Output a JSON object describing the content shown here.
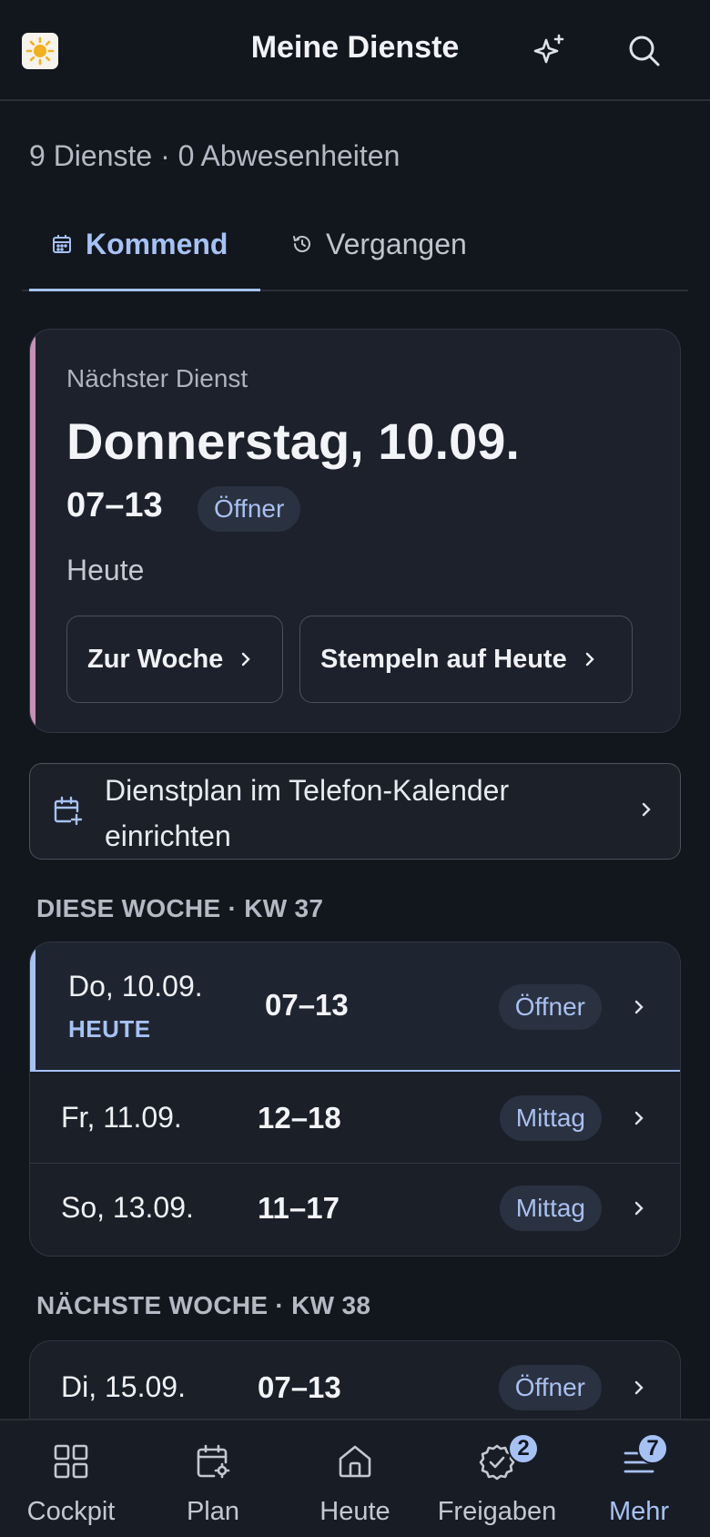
{
  "header": {
    "title": "Meine Dienste",
    "logo_icon": "sun-icon",
    "actions": [
      "sparkles-icon",
      "search-icon"
    ]
  },
  "summary": "9 Dienste · 0 Abwesenheiten",
  "tabs": [
    {
      "label": "Kommend",
      "icon": "calendar-icon",
      "active": true
    },
    {
      "label": "Vergangen",
      "icon": "history-icon",
      "active": false
    }
  ],
  "next_shift": {
    "label": "Nächster Dienst",
    "date": "Donnerstag, 10.09.",
    "time": "07–13",
    "role": "Öffner",
    "relative": "Heute",
    "btn_week": "Zur Woche",
    "btn_clock": "Stempeln auf Heute"
  },
  "calendar_banner": {
    "text": "Dienstplan im Telefon-Kalender einrichten"
  },
  "this_week": {
    "title": "DIESE WOCHE · KW 37",
    "rows": [
      {
        "day": "Do, 10.09.",
        "today_label": "HEUTE",
        "time": "07–13",
        "role": "Öffner"
      },
      {
        "day": "Fr, 11.09.",
        "time": "12–18",
        "role": "Mittag"
      },
      {
        "day": "So, 13.09.",
        "time": "11–17",
        "role": "Mittag"
      }
    ]
  },
  "next_week": {
    "title": "NÄCHSTE WOCHE · KW 38",
    "rows": [
      {
        "day": "Di, 15.09.",
        "time": "07–13",
        "role": "Öffner"
      }
    ]
  },
  "bottom_nav": [
    {
      "label": "Cockpit",
      "icon": "grid-icon"
    },
    {
      "label": "Plan",
      "icon": "calendar-settings-icon"
    },
    {
      "label": "Heute",
      "icon": "home-icon"
    },
    {
      "label": "Freigaben",
      "icon": "badge-check-icon",
      "badge": "2"
    },
    {
      "label": "Mehr",
      "icon": "menu-icon",
      "badge": "7",
      "active": true
    }
  ],
  "colors": {
    "background": "#12161d",
    "accent": "#a6c2f5",
    "next_card_accent": "#c98fb5",
    "logo_sun": "#f2b01e"
  }
}
